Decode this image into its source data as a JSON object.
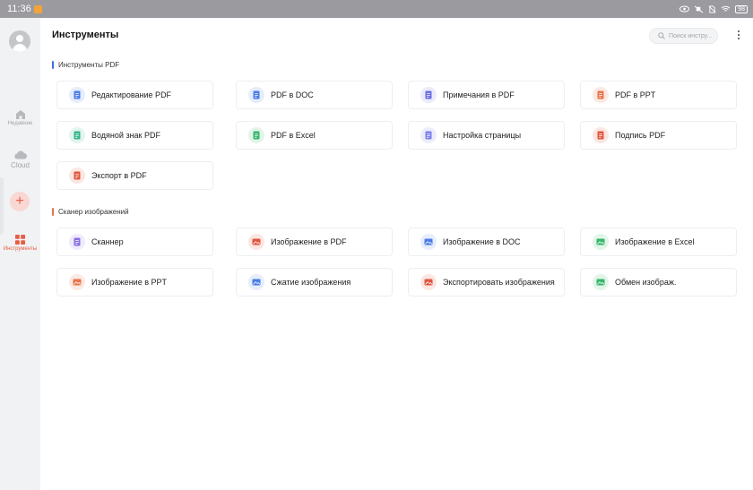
{
  "status_bar": {
    "time": "11:36",
    "battery": "98"
  },
  "sidebar": {
    "items": [
      {
        "label": "Недавние"
      },
      {
        "label": "Cloud"
      },
      {
        "label": "Инструменты"
      }
    ],
    "add_label": "+"
  },
  "header": {
    "title": "Инструменты",
    "search_placeholder": "Поиск инстру..."
  },
  "sections": [
    {
      "title": "Инструменты PDF",
      "accent": "#3b6fd8",
      "tools": [
        {
          "label": "Редактирование PDF",
          "icon": "edit-pdf-icon",
          "color": "#4a7be8",
          "bg": "#e6edfb"
        },
        {
          "label": "PDF в DOC",
          "icon": "pdf-to-doc-icon",
          "color": "#4a7be8",
          "bg": "#e6edfb"
        },
        {
          "label": "Примечания в PDF",
          "icon": "annotate-pdf-icon",
          "color": "#6b6fe3",
          "bg": "#ebebfb"
        },
        {
          "label": "PDF в PPT",
          "icon": "pdf-to-ppt-icon",
          "color": "#e8734a",
          "bg": "#fbeae3"
        },
        {
          "label": "Водяной знак PDF",
          "icon": "watermark-pdf-icon",
          "color": "#35b58a",
          "bg": "#e2f5ee"
        },
        {
          "label": "PDF в Excel",
          "icon": "pdf-to-excel-icon",
          "color": "#35b56a",
          "bg": "#e2f5e8"
        },
        {
          "label": "Настройка страницы",
          "icon": "page-setup-icon",
          "color": "#7b7fe8",
          "bg": "#ecedfb"
        },
        {
          "label": "Подпись PDF",
          "icon": "sign-pdf-icon",
          "color": "#e0553d",
          "bg": "#fbe6e2"
        },
        {
          "label": "Экспорт в PDF",
          "icon": "export-pdf-icon",
          "color": "#e0553d",
          "bg": "#fbe6e2"
        }
      ]
    },
    {
      "title": "Сканер изображений",
      "accent": "#e8734a",
      "tools": [
        {
          "label": "Сканнер",
          "icon": "scanner-icon",
          "color": "#8a6fe3",
          "bg": "#efebfb"
        },
        {
          "label": "Изображение в PDF",
          "icon": "image-to-pdf-icon",
          "color": "#e0553d",
          "bg": "#fbe6e2"
        },
        {
          "label": "Изображение в DOC",
          "icon": "image-to-doc-icon",
          "color": "#4a7be8",
          "bg": "#e6edfb"
        },
        {
          "label": "Изображение в Excel",
          "icon": "image-to-excel-icon",
          "color": "#35b56a",
          "bg": "#e2f5e8"
        },
        {
          "label": "Изображение в PPT",
          "icon": "image-to-ppt-icon",
          "color": "#e8734a",
          "bg": "#fbeae3"
        },
        {
          "label": "Сжатие изображения",
          "icon": "compress-image-icon",
          "color": "#4a7be8",
          "bg": "#e6edfb"
        },
        {
          "label": "Экспортировать изображения",
          "icon": "export-images-icon",
          "color": "#e0553d",
          "bg": "#fbe6e2"
        },
        {
          "label": "Обмен изображ.",
          "icon": "share-images-icon",
          "color": "#35b56a",
          "bg": "#e2f5e8"
        }
      ]
    }
  ]
}
